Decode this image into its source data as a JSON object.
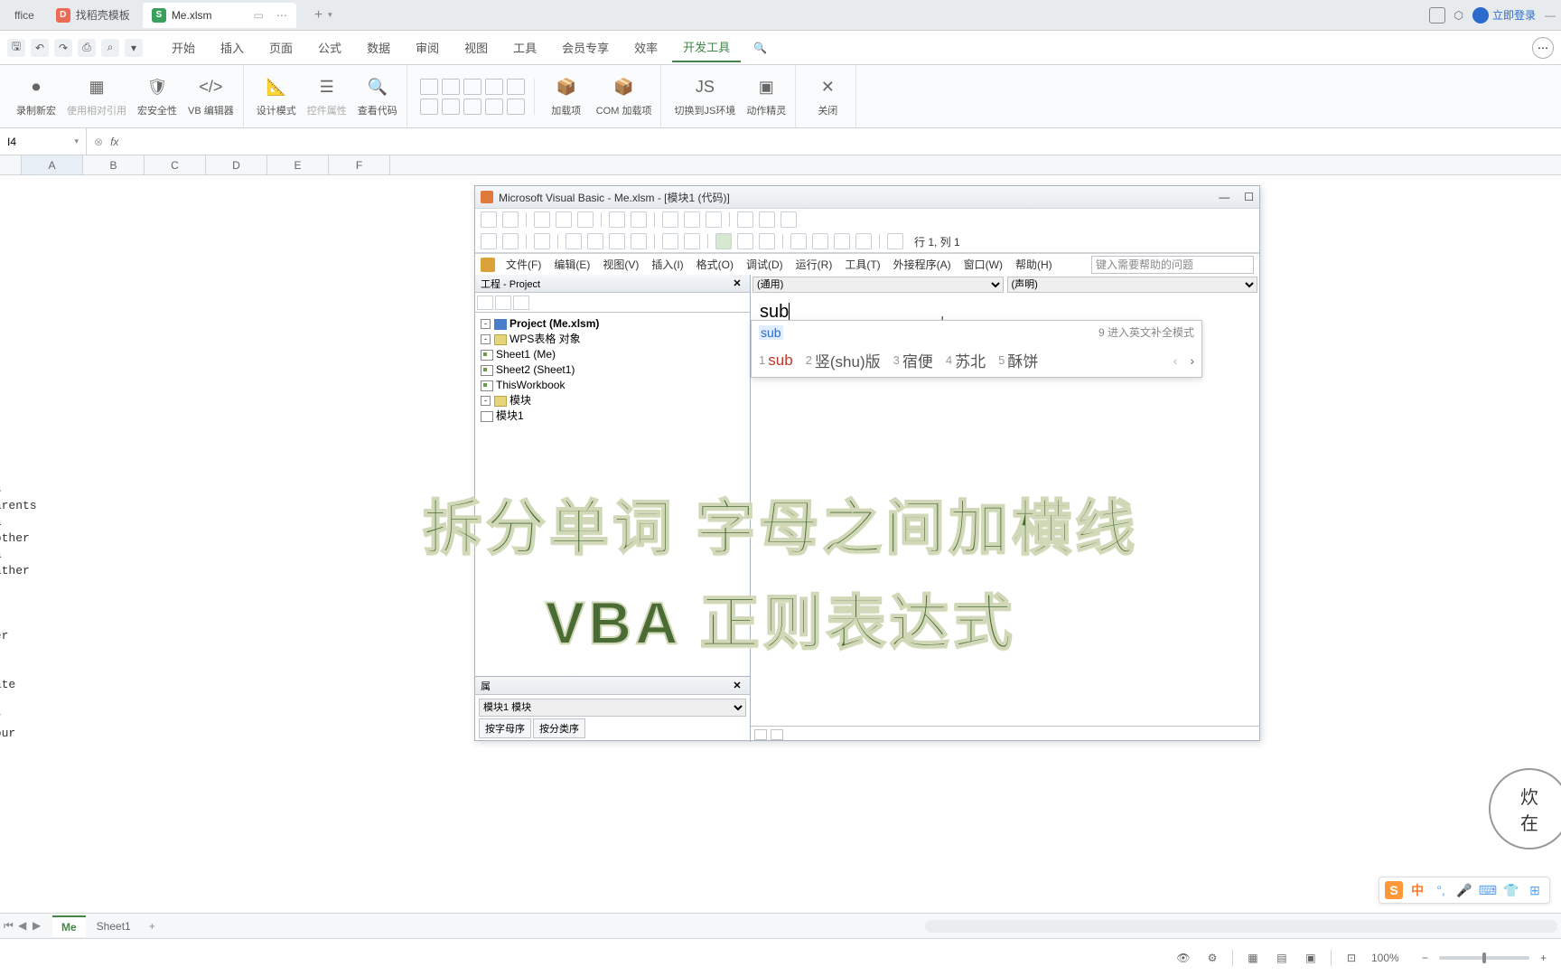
{
  "titlebar": {
    "tabs": [
      {
        "label": "ffice",
        "active": false,
        "color": "#e8ebee"
      },
      {
        "label": "找稻壳模板",
        "active": false,
        "ico_bg": "#ed6b55",
        "ico_txt": "D"
      },
      {
        "label": "Me.xlsm",
        "active": true,
        "ico_bg": "#3a9e5c",
        "ico_txt": "S"
      }
    ],
    "login": "立即登录"
  },
  "ribbon_tabs": [
    "开始",
    "插入",
    "页面",
    "公式",
    "数据",
    "审阅",
    "视图",
    "工具",
    "会员专享",
    "效率",
    "开发工具"
  ],
  "ribbon_active": "开发工具",
  "ribbon_btns": {
    "g1": [
      "录制新宏",
      "使用相对引用",
      "宏安全性",
      "VB 编辑器"
    ],
    "g2": [
      "设计模式",
      "控件属性",
      "查看代码"
    ],
    "g3": [
      "加载项",
      "COM 加载项"
    ],
    "g4": [
      "切换到JS环境",
      "动作精灵"
    ],
    "g5": [
      "关闭"
    ]
  },
  "name_box": "I4",
  "fx": "fx",
  "columns": [
    "A",
    "B",
    "C",
    "D",
    "E",
    "F"
  ],
  "cells": [
    {
      "row": 340,
      "text": "ts"
    },
    {
      "row": 358,
      "text": "parents"
    },
    {
      "row": 376,
      "text": "na"
    },
    {
      "row": 394,
      "text": "nother"
    },
    {
      "row": 412,
      "text": "pa"
    },
    {
      "row": 430,
      "text": "father"
    },
    {
      "row": 466,
      "text": "n"
    },
    {
      "row": 502,
      "text": "ter"
    },
    {
      "row": 556,
      "text": "nate"
    },
    {
      "row": 592,
      "text": "pr"
    },
    {
      "row": 610,
      "text": "pour"
    }
  ],
  "vba": {
    "title": "Microsoft Visual Basic - Me.xlsm - [模块1 (代码)]",
    "position": "行 1, 列 1",
    "menus": [
      "文件(F)",
      "编辑(E)",
      "视图(V)",
      "插入(I)",
      "格式(O)",
      "调试(D)",
      "运行(R)",
      "工具(T)",
      "外接程序(A)",
      "窗口(W)",
      "帮助(H)"
    ],
    "help_placeholder": "键入需要帮助的问题",
    "project_title": "工程 - Project",
    "tree": {
      "root": "Project (Me.xlsm)",
      "group1": "WPS表格 对象",
      "sheets": [
        "Sheet1 (Me)",
        "Sheet2 (Sheet1)",
        "ThisWorkbook"
      ],
      "group2": "模块",
      "modules": [
        "模块1"
      ]
    },
    "prop_select": "模块1 模块",
    "prop_tabs": [
      "按字母序",
      "按分类序"
    ],
    "dropdown_left": "(通用)",
    "dropdown_right": "(声明)",
    "code": "sub"
  },
  "ime": {
    "input": "sub",
    "hint": "9 进入英文补全模式",
    "candidates": [
      {
        "n": "1",
        "t": "sub",
        "cls": "txt"
      },
      {
        "n": "2",
        "t": "竖(shu)版",
        "cls": "txt alt",
        "sup": "①"
      },
      {
        "n": "3",
        "t": "宿便",
        "cls": "txt alt"
      },
      {
        "n": "4",
        "t": "苏北",
        "cls": "txt alt"
      },
      {
        "n": "5",
        "t": "酥饼",
        "cls": "txt alt"
      }
    ]
  },
  "overlay": {
    "line1": "拆分单词 字母之间加横线",
    "line2": "VBA 正则表达式"
  },
  "ime_bar": {
    "zhong": "中"
  },
  "sheet_tabs": {
    "active": "Me",
    "other": "Sheet1"
  },
  "status": {
    "zoom": "100%"
  },
  "watermark": "炊\n在"
}
